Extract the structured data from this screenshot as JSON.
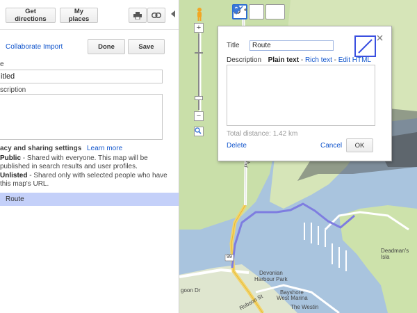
{
  "toolbar": {
    "get_directions": "Get directions",
    "my_places": "My places"
  },
  "panel": {
    "collaborate": "Collaborate",
    "import": "Import",
    "done": "Done",
    "save": "Save",
    "title_label": "e",
    "title_value": "itled",
    "description_label": "scription",
    "privacy_heading": "acy and sharing settings",
    "learn_more": "Learn more",
    "public_label": "Public",
    "public_desc_1": " - Shared with everyone. This map will be",
    "public_desc_2": "published in search results and user profiles.",
    "unlisted_label": "Unlisted",
    "unlisted_desc_1": " - Shared only with selected people who have",
    "unlisted_desc_2": "this map's URL.",
    "route_item": "Route"
  },
  "infowindow": {
    "title_label": "Title",
    "title_value": "Route",
    "description_label": "Description",
    "plain_text": "Plain text",
    "rich_text": "Rich text",
    "edit_html": "Edit HTML",
    "separator": " - ",
    "total_distance": "Total distance: 1.42 km",
    "delete": "Delete",
    "cancel": "Cancel",
    "ok": "OK",
    "line_color": "#3a4fe0"
  },
  "map_labels": {
    "pipeline": "Pipeline",
    "devonian": "Devonian",
    "harbour_park": "Harbour Park",
    "bayshore": "Bayshore",
    "west_marina": "West Marina",
    "the_westin": "The Westin",
    "deadmans": "Deadman's Isla",
    "robson": "Robson St",
    "gigoon": "goon Dr",
    "highway": "99"
  },
  "colors": {
    "route": "#7e7de0",
    "water": "#a9c4de",
    "park": "#c9dfa9",
    "active_mode": "#2d6ed1"
  }
}
